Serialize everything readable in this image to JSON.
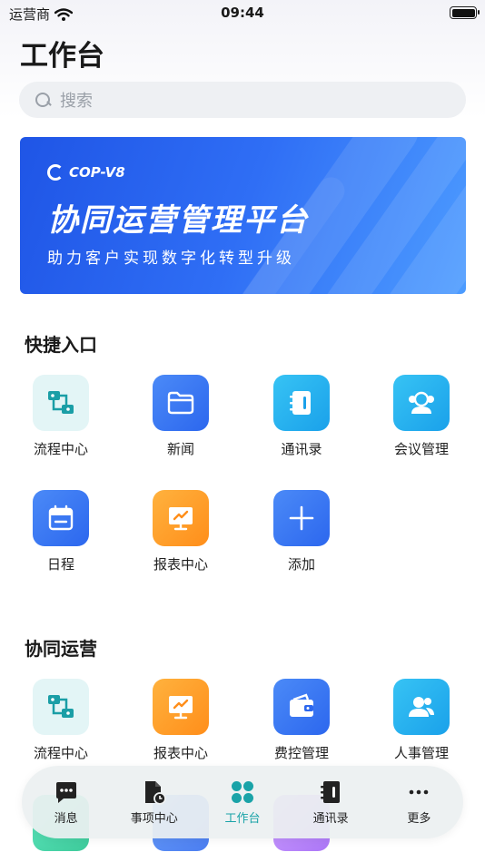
{
  "status_bar": {
    "carrier": "运营商",
    "time": "09:44"
  },
  "page": {
    "title": "工作台"
  },
  "search": {
    "placeholder": "搜索"
  },
  "banner": {
    "brand": "COP-V8",
    "title": "协同运营管理平台",
    "subtitle": "助力客户实现数字化转型升级"
  },
  "quick_access": {
    "title": "快捷入口",
    "items": [
      {
        "label": "流程中心",
        "icon": "flow-icon"
      },
      {
        "label": "新闻",
        "icon": "folder-icon"
      },
      {
        "label": "通讯录",
        "icon": "address-book-icon"
      },
      {
        "label": "会议管理",
        "icon": "meeting-icon"
      },
      {
        "label": "日程",
        "icon": "calendar-icon"
      },
      {
        "label": "报表中心",
        "icon": "report-icon"
      },
      {
        "label": "添加",
        "icon": "plus-icon"
      }
    ]
  },
  "collab_ops": {
    "title": "协同运营",
    "items": [
      {
        "label": "流程中心",
        "icon": "flow-icon"
      },
      {
        "label": "报表中心",
        "icon": "report-icon"
      },
      {
        "label": "费控管理",
        "icon": "wallet-icon"
      },
      {
        "label": "人事管理",
        "icon": "users-icon"
      }
    ]
  },
  "tabbar": {
    "items": [
      {
        "label": "消息",
        "icon": "message-icon"
      },
      {
        "label": "事项中心",
        "icon": "document-clock-icon"
      },
      {
        "label": "工作台",
        "icon": "workbench-icon",
        "active": true
      },
      {
        "label": "通讯录",
        "icon": "address-book-icon"
      },
      {
        "label": "更多",
        "icon": "more-icon"
      }
    ]
  },
  "colors": {
    "accent": "#1aa3a8",
    "primary_blue": "#2c67ee",
    "orange": "#ff8e1a",
    "cyan": "#1aa1ea"
  }
}
